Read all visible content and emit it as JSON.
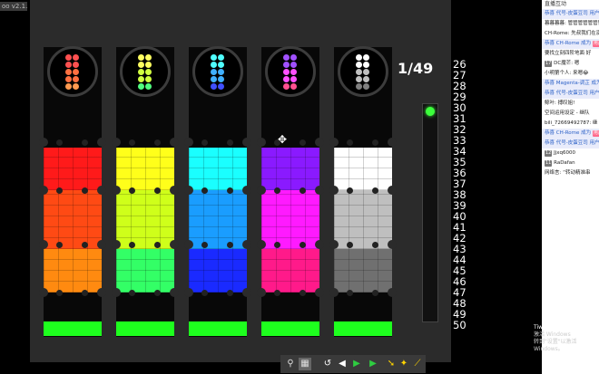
{
  "app": {
    "version": "oo v2.1.0"
  },
  "game": {
    "counter": "1/49",
    "numbers": [
      "26",
      "27",
      "28",
      "29",
      "30",
      "31",
      "32",
      "33",
      "34",
      "35",
      "36",
      "37",
      "38",
      "39",
      "40",
      "41",
      "42",
      "43",
      "44",
      "45",
      "46",
      "47",
      "48",
      "49",
      "50"
    ],
    "tubes": [
      {
        "id": "red",
        "base": "#ff1a1a",
        "colors": [
          "#ff1a1a",
          "#ff4a14",
          "#ff8a10"
        ],
        "ball_colors": [
          "#ff5050",
          "#ff7040",
          "#ff9a50"
        ]
      },
      {
        "id": "yellow",
        "base": "#ffff1a",
        "colors": [
          "#ffff1a",
          "#cfff1a",
          "#33ff66"
        ],
        "ball_colors": [
          "#ffff60",
          "#d0ff40",
          "#50ff80"
        ]
      },
      {
        "id": "cyan",
        "base": "#1affff",
        "colors": [
          "#1affff",
          "#1a9dff",
          "#1a2aff"
        ],
        "ball_colors": [
          "#50ffff",
          "#40b0ff",
          "#4050ff"
        ]
      },
      {
        "id": "magenta",
        "base": "#8a1aff",
        "colors": [
          "#8a1aff",
          "#ff1aff",
          "#ff1a8a"
        ],
        "ball_colors": [
          "#a050ff",
          "#ff50ff",
          "#ff5090"
        ]
      },
      {
        "id": "white",
        "base": "#ffffff",
        "colors": [
          "#ffffff",
          "#bfbfbf",
          "#707070"
        ],
        "ball_colors": [
          "#ffffff",
          "#c0c0c0",
          "#808080"
        ]
      }
    ],
    "meter_color": "#3cff3c"
  },
  "toolbar": {
    "buttons": [
      {
        "name": "zoom-icon",
        "glyph": "⚲"
      },
      {
        "name": "grid-icon",
        "glyph": "▦"
      },
      {
        "name": "undo-icon",
        "glyph": "↺"
      },
      {
        "name": "back-icon",
        "glyph": "◀"
      },
      {
        "name": "play-icon",
        "glyph": "▶"
      },
      {
        "name": "step-icon",
        "glyph": "▶"
      },
      {
        "name": "arrow-icon",
        "glyph": "➘"
      },
      {
        "name": "star-icon",
        "glyph": "✦"
      },
      {
        "name": "wand-icon",
        "glyph": "⟋"
      }
    ]
  },
  "chat": {
    "header": "直播互动",
    "messages": [
      {
        "type": "gift",
        "text": "恭喜 代号-皮蛋豆司 用户",
        "tag": "用户"
      },
      {
        "type": "text",
        "text": "暮暮暮暮: 管管管管管管管！！！！"
      },
      {
        "type": "text",
        "text": "CH-Rome: 先叔我们在演道"
      },
      {
        "type": "gift",
        "text": "恭喜 CH-Rome 成为",
        "tag": "用户"
      },
      {
        "type": "text",
        "text": "要找立刻四阶地面 好"
      },
      {
        "type": "fan",
        "text": "DC魔芒: 嗯",
        "badge": "17"
      },
      {
        "type": "text",
        "text": "小明第个人: 来嗯😂"
      },
      {
        "type": "gift",
        "text": "恭喜 Magenta-调芷 成为高能用户",
        "tag": "用户"
      },
      {
        "type": "gift",
        "text": "恭喜 代号-皮蛋豆司 用户",
        "tag": "用户"
      },
      {
        "type": "text",
        "text": "鲸叶: 搏叹姐!"
      },
      {
        "type": "text",
        "text": "空间运用设定 - 继队"
      },
      {
        "type": "text",
        "text": "bili_72669492787: 继"
      },
      {
        "type": "gift",
        "text": "恭喜 CH-Rome 成为",
        "tag": "用户"
      },
      {
        "type": "gift",
        "text": "恭喜 代号-皮蛋豆司 用户",
        "tag": "用户"
      },
      {
        "type": "fan",
        "text": "Jjxq6000",
        "badge": "12"
      },
      {
        "type": "fan",
        "text": "RaDafan",
        "badge": "11"
      },
      {
        "type": "text",
        "text": "网络言: “转动精准串"
      }
    ]
  },
  "watermark": {
    "line1": "激活 Windows",
    "line2": "转到\"设置\"以激活 Windows。",
    "name": "Tiwpe Official"
  }
}
